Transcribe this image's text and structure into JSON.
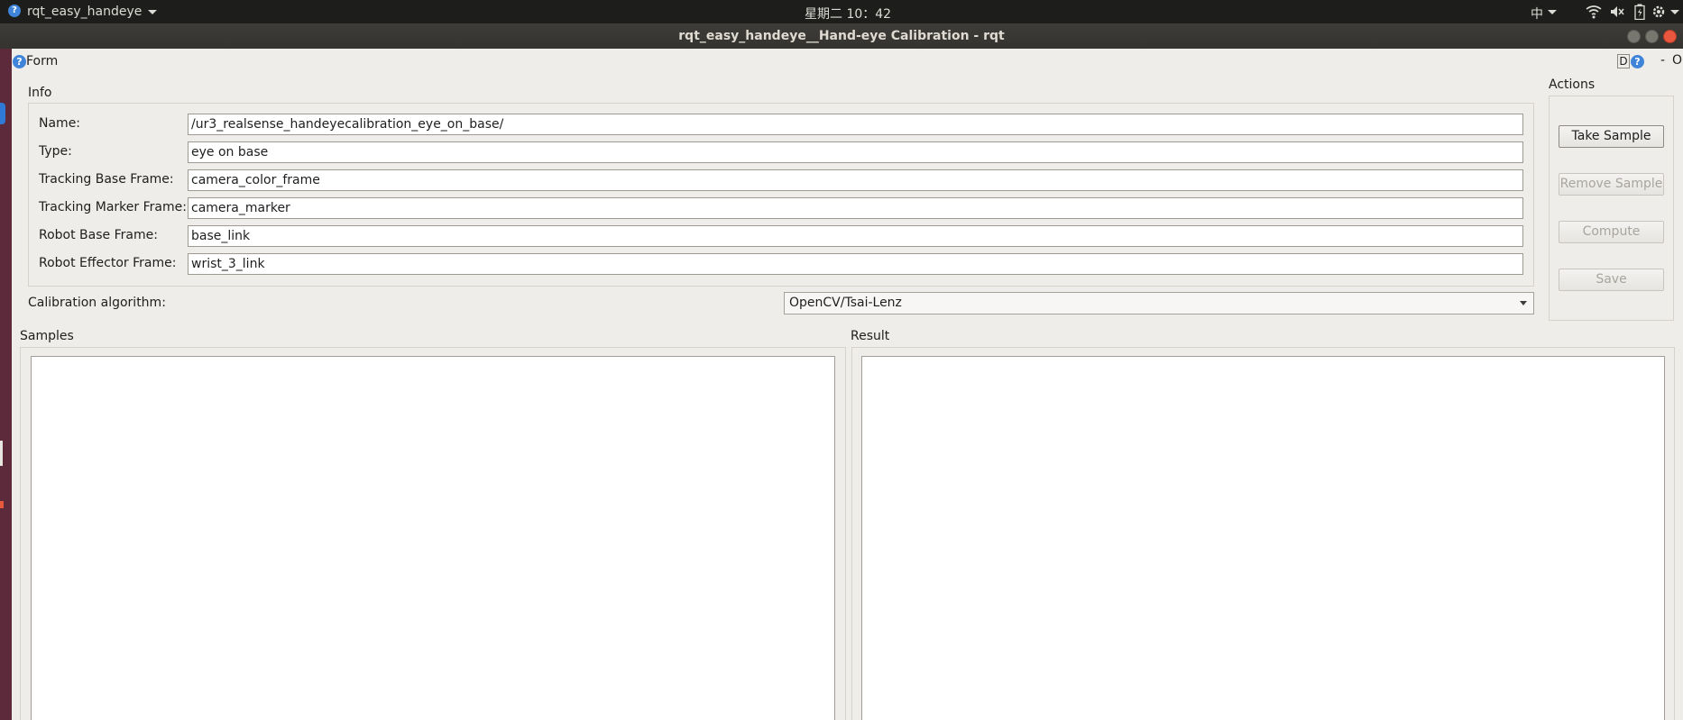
{
  "top_panel": {
    "app_menu": "rqt_easy_handeye",
    "clock": "星期二 10：42",
    "input_method": "中"
  },
  "window": {
    "title": "rqt_easy_handeye__Hand-eye Calibration - rqt"
  },
  "plugin": {
    "name": "Form",
    "header_buttons": {
      "d": "D",
      "dash": "-",
      "o": "O"
    }
  },
  "info": {
    "group_label": "Info",
    "fields": [
      {
        "label": "Name:",
        "value": "/ur3_realsense_handeyecalibration_eye_on_base/"
      },
      {
        "label": "Type:",
        "value": "eye on base"
      },
      {
        "label": "Tracking Base Frame:",
        "value": "camera_color_frame"
      },
      {
        "label": "Tracking Marker Frame:",
        "value": "camera_marker"
      },
      {
        "label": "Robot Base Frame:",
        "value": "base_link"
      },
      {
        "label": "Robot Effector Frame:",
        "value": "wrist_3_link"
      }
    ]
  },
  "calibration": {
    "label": "Calibration algorithm:",
    "selected": "OpenCV/Tsai-Lenz"
  },
  "actions": {
    "group_label": "Actions",
    "buttons": [
      {
        "label": "Take Sample",
        "enabled": true
      },
      {
        "label": "Remove Sample",
        "enabled": false
      },
      {
        "label": "Compute",
        "enabled": false
      },
      {
        "label": "Save",
        "enabled": false
      }
    ]
  },
  "samples": {
    "group_label": "Samples"
  },
  "result": {
    "group_label": "Result"
  }
}
